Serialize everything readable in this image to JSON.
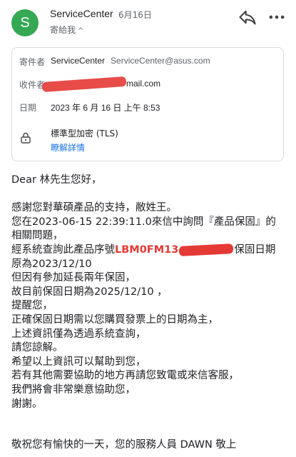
{
  "header": {
    "avatar_letter": "S",
    "sender_name": "ServiceCenter",
    "date": "6月16日",
    "to_me": "寄給我",
    "chevron": "^",
    "reply_icon": "reply-icon",
    "more_icon": "more-vert-icon"
  },
  "details": {
    "from_label": "寄件者",
    "from_name": "ServiceCenter",
    "from_email": "ServiceCenter@asus.com",
    "to_label": "收件者",
    "to_email_visible": "mail.com",
    "date_label": "日期",
    "date_value": "2023 年 6 月 16 日 上午 8:53",
    "security_icon": "lock-icon",
    "encryption": "標準型加密 (TLS)",
    "details_link": "瞭解詳情"
  },
  "body": {
    "greeting": "Dear 林先生您好，",
    "lines": [
      "感謝您對華碩產品的支持，敝姓王。",
      "您在2023-06-15 22:39:11.0來信中詢問『產品保固』的",
      "相關問題，"
    ],
    "serial_prefix": "經系統查詢此產品序號",
    "serial_visible": "LBM0FM13",
    "serial_suffix": "保固日期",
    "lines2": [
      "原為2023/12/10",
      "但因有參加延長兩年保固，",
      "故目前保固日期為2025/12/10 ，",
      "提醒您，",
      "正確保固日期需以您購買發票上的日期為主，",
      "上述資訊僅為透過系統查詢，",
      "請您諒解。",
      "希望以上資訊可以幫助到您，",
      "若有其他需要協助的地方再請您致電或來信客服，",
      "我們將會非常樂意協助您，",
      "謝謝。"
    ],
    "closing": "敬祝您有愉快的一天，您的服務人員 DAWN 敬上"
  },
  "colors": {
    "avatar": "#34a853",
    "link": "#1a73e8",
    "redaction": "#e53935"
  }
}
